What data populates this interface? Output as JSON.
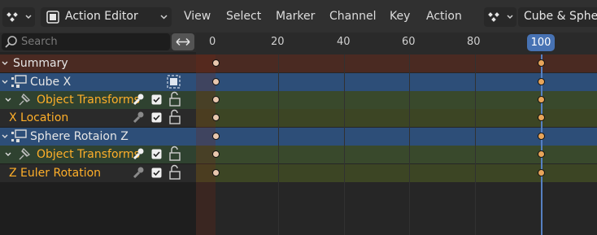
{
  "header": {
    "editor_mode": "Action Editor",
    "menu": [
      "View",
      "Select",
      "Marker",
      "Channel",
      "Key",
      "Action"
    ],
    "action_name": "Cube & Spher"
  },
  "search": {
    "placeholder": "Search"
  },
  "timeline": {
    "frame_labels": [
      "0",
      "20",
      "40",
      "60",
      "80"
    ],
    "current_frame": "100"
  },
  "channels": [
    {
      "label": "Summary",
      "kind": "summary"
    },
    {
      "label": "Cube X",
      "kind": "object"
    },
    {
      "label": "Object Transforms",
      "kind": "group"
    },
    {
      "label": "X Location",
      "kind": "fcurve"
    },
    {
      "label": "Sphere Rotaion Z",
      "kind": "object"
    },
    {
      "label": "Object Transforms",
      "kind": "group"
    },
    {
      "label": "Z Euler Rotation",
      "kind": "fcurve"
    }
  ],
  "keyframe_frames": [
    0,
    100
  ],
  "colors": {
    "summary_row": "#4a2a22",
    "object_row": "#2d4e78",
    "group_row": "#2f4230",
    "fcurve_row": "#2a2a2a",
    "group_text": "#ffaf29",
    "playhead": "#4772b3"
  }
}
